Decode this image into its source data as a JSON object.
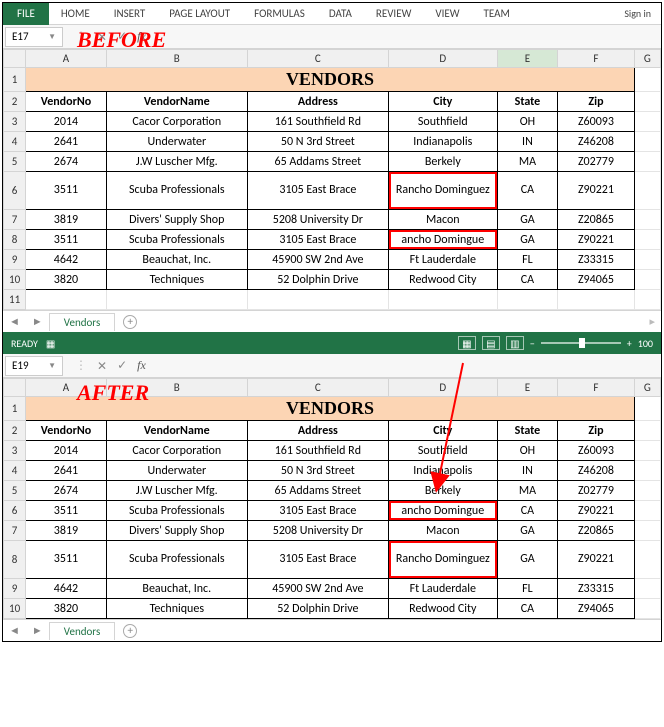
{
  "ribbon": {
    "file": "FILE",
    "tabs": [
      "HOME",
      "INSERT",
      "PAGE LAYOUT",
      "FORMULAS",
      "DATA",
      "REVIEW",
      "VIEW",
      "TEAM"
    ],
    "signin": "Sign in"
  },
  "labels": {
    "before": "BEFORE",
    "after": "AFTER"
  },
  "before": {
    "namebox": "E17",
    "fx": "fx",
    "title": "VENDORS",
    "sheet_tab": "Vendors",
    "cols": [
      "",
      "A",
      "B",
      "C",
      "D",
      "E",
      "F",
      "G"
    ],
    "header": [
      "VendorNo",
      "VendorName",
      "Address",
      "City",
      "State",
      "Zip"
    ],
    "rows": [
      {
        "n": 3,
        "d": [
          "2014",
          "Cacor Corporation",
          "161 Southfield Rd",
          "Southfield",
          "OH",
          "Z60093"
        ]
      },
      {
        "n": 4,
        "d": [
          "2641",
          "Underwater",
          "50 N 3rd Street",
          "Indianapolis",
          "IN",
          "Z46208"
        ]
      },
      {
        "n": 5,
        "d": [
          "2674",
          "J.W Luscher Mfg.",
          "65 Addams Street",
          "Berkely",
          "MA",
          "Z02779"
        ]
      },
      {
        "n": 6,
        "tall": true,
        "d": [
          "3511",
          "Scuba Professionals",
          "3105 East Brace",
          "Rancho Dominguez",
          "CA",
          "Z90221"
        ],
        "redCity": true
      },
      {
        "n": 7,
        "d": [
          "3819",
          "Divers' Supply Shop",
          "5208 University Dr",
          "Macon",
          "GA",
          "Z20865"
        ]
      },
      {
        "n": 8,
        "d": [
          "3511",
          "Scuba Professionals",
          "3105 East Brace",
          "ancho Domingue",
          "GA",
          "Z90221"
        ],
        "redCity": true
      },
      {
        "n": 9,
        "d": [
          "4642",
          "Beauchat, Inc.",
          "45900 SW 2nd Ave",
          "Ft Lauderdale",
          "FL",
          "Z33315"
        ]
      },
      {
        "n": 10,
        "d": [
          "3820",
          "Techniques",
          "52 Dolphin Drive",
          "Redwood City",
          "CA",
          "Z94065"
        ]
      }
    ],
    "status": {
      "ready": "READY",
      "zoom": "100"
    }
  },
  "after": {
    "namebox": "E19",
    "fx": "fx",
    "title": "VENDORS",
    "sheet_tab": "Vendors",
    "cols": [
      "",
      "A",
      "B",
      "C",
      "D",
      "E",
      "F",
      "G"
    ],
    "header": [
      "VendorNo",
      "VendorName",
      "Address",
      "City",
      "State",
      "Zip"
    ],
    "rows": [
      {
        "n": 3,
        "d": [
          "2014",
          "Cacor Corporation",
          "161 Southfield Rd",
          "Southfield",
          "OH",
          "Z60093"
        ]
      },
      {
        "n": 4,
        "d": [
          "2641",
          "Underwater",
          "50 N 3rd Street",
          "Indianapolis",
          "IN",
          "Z46208"
        ]
      },
      {
        "n": 5,
        "d": [
          "2674",
          "J.W Luscher Mfg.",
          "65 Addams Street",
          "Berkely",
          "MA",
          "Z02779"
        ]
      },
      {
        "n": 6,
        "d": [
          "3511",
          "Scuba Professionals",
          "3105 East Brace",
          "ancho Domingue",
          "CA",
          "Z90221"
        ],
        "redCity": true
      },
      {
        "n": 7,
        "d": [
          "3819",
          "Divers' Supply Shop",
          "5208 University Dr",
          "Macon",
          "GA",
          "Z20865"
        ]
      },
      {
        "n": 8,
        "tall": true,
        "d": [
          "3511",
          "Scuba Professionals",
          "3105 East Brace",
          "Rancho Dominguez",
          "GA",
          "Z90221"
        ],
        "redCity": true
      },
      {
        "n": 9,
        "d": [
          "4642",
          "Beauchat, Inc.",
          "45900 SW 2nd Ave",
          "Ft Lauderdale",
          "FL",
          "Z33315"
        ]
      },
      {
        "n": 10,
        "d": [
          "3820",
          "Techniques",
          "52 Dolphin Drive",
          "Redwood City",
          "CA",
          "Z94065"
        ]
      }
    ]
  }
}
